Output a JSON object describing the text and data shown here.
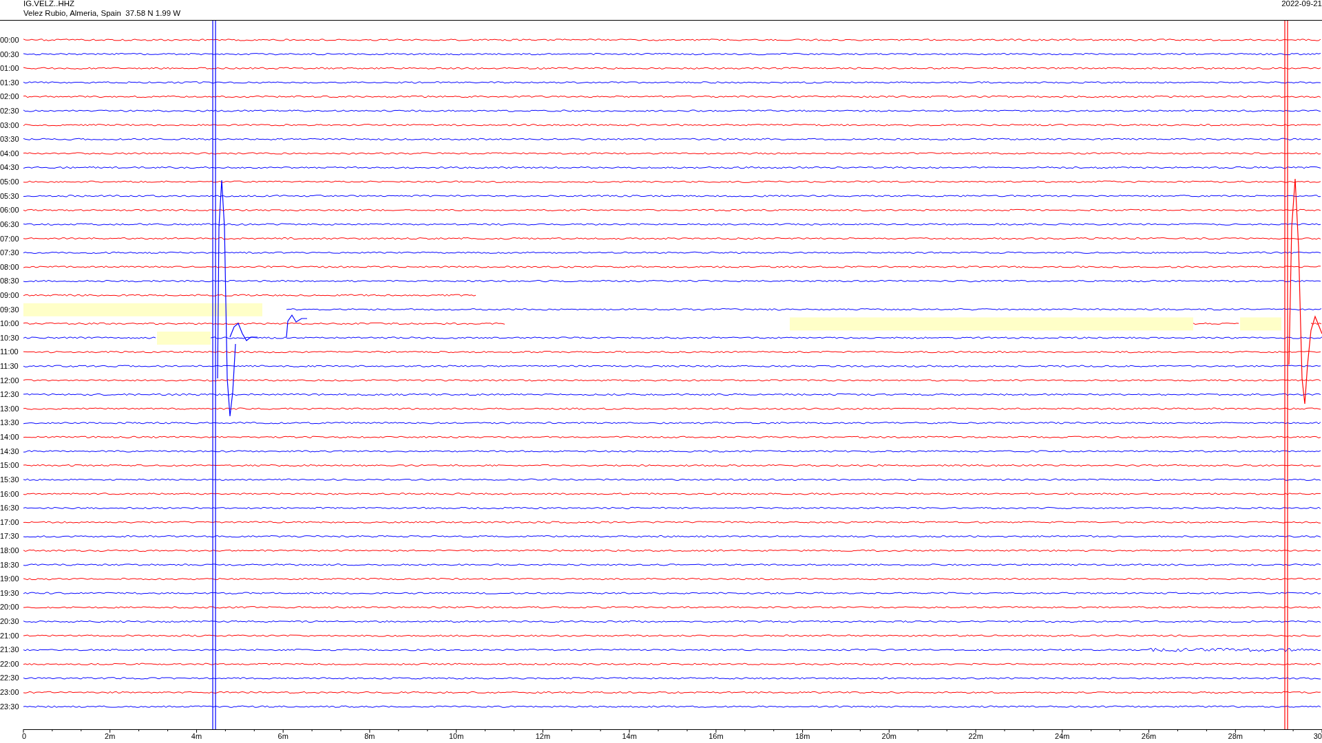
{
  "header": {
    "station": "IG.VELZ..HHZ",
    "location": "Velez Rubio, Almeria, Spain  37.58 N 1.99 W",
    "date": "2022-09-21"
  },
  "rows": [
    {
      "label": "00:00",
      "color": "#ff0000"
    },
    {
      "label": "00:30",
      "color": "#0000ff"
    },
    {
      "label": "01:00",
      "color": "#ff0000"
    },
    {
      "label": "01:30",
      "color": "#0000ff"
    },
    {
      "label": "02:00",
      "color": "#ff0000"
    },
    {
      "label": "02:30",
      "color": "#0000ff"
    },
    {
      "label": "03:00",
      "color": "#ff0000"
    },
    {
      "label": "03:30",
      "color": "#0000ff"
    },
    {
      "label": "04:00",
      "color": "#ff0000"
    },
    {
      "label": "04:30",
      "color": "#0000ff"
    },
    {
      "label": "05:00",
      "color": "#ff0000"
    },
    {
      "label": "05:30",
      "color": "#0000ff"
    },
    {
      "label": "06:00",
      "color": "#ff0000"
    },
    {
      "label": "06:30",
      "color": "#0000ff"
    },
    {
      "label": "07:00",
      "color": "#ff0000"
    },
    {
      "label": "07:30",
      "color": "#0000ff"
    },
    {
      "label": "08:00",
      "color": "#ff0000"
    },
    {
      "label": "08:30",
      "color": "#0000ff"
    },
    {
      "label": "09:00",
      "color": "#ff0000"
    },
    {
      "label": "09:30",
      "color": "#0000ff"
    },
    {
      "label": "10:00",
      "color": "#ff0000"
    },
    {
      "label": "10:30",
      "color": "#0000ff"
    },
    {
      "label": "11:00",
      "color": "#ff0000"
    },
    {
      "label": "11:30",
      "color": "#0000ff"
    },
    {
      "label": "12:00",
      "color": "#ff0000"
    },
    {
      "label": "12:30",
      "color": "#0000ff"
    },
    {
      "label": "13:00",
      "color": "#ff0000"
    },
    {
      "label": "13:30",
      "color": "#0000ff"
    },
    {
      "label": "14:00",
      "color": "#ff0000"
    },
    {
      "label": "14:30",
      "color": "#0000ff"
    },
    {
      "label": "15:00",
      "color": "#ff0000"
    },
    {
      "label": "15:30",
      "color": "#0000ff"
    },
    {
      "label": "16:00",
      "color": "#ff0000"
    },
    {
      "label": "16:30",
      "color": "#0000ff"
    },
    {
      "label": "17:00",
      "color": "#ff0000"
    },
    {
      "label": "17:30",
      "color": "#0000ff"
    },
    {
      "label": "18:00",
      "color": "#ff0000"
    },
    {
      "label": "18:30",
      "color": "#0000ff"
    },
    {
      "label": "19:00",
      "color": "#ff0000"
    },
    {
      "label": "19:30",
      "color": "#0000ff"
    },
    {
      "label": "20:00",
      "color": "#ff0000"
    },
    {
      "label": "20:30",
      "color": "#0000ff"
    },
    {
      "label": "21:00",
      "color": "#ff0000"
    },
    {
      "label": "21:30",
      "color": "#0000ff"
    },
    {
      "label": "22:00",
      "color": "#ff0000"
    },
    {
      "label": "22:30",
      "color": "#0000ff"
    },
    {
      "label": "23:00",
      "color": "#ff0000"
    },
    {
      "label": "23:30",
      "color": "#0000ff"
    }
  ],
  "x_axis": {
    "labels": [
      "0",
      "2m",
      "4m",
      "6m",
      "8m",
      "10m",
      "12m",
      "14m",
      "16m",
      "18m",
      "20m",
      "22m",
      "24m",
      "26m",
      "28m",
      "30"
    ]
  }
}
